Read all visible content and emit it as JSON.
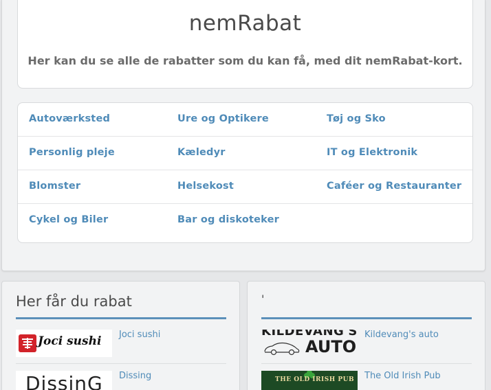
{
  "header": {
    "title": "nemRabat",
    "subtitle": "Her kan du se alle de rabatter som du kan få, med dit nemRabat-kort."
  },
  "categories": [
    [
      "Autoværksted",
      "Ure og Optikere",
      "Tøj og Sko"
    ],
    [
      "Personlig pleje",
      "Kæledyr",
      "IT og Elektronik"
    ],
    [
      "Blomster",
      "Helsekost",
      "Caféer og Restauranter"
    ],
    [
      "Cykel og Biler",
      "Bar og diskoteker",
      ""
    ]
  ],
  "left_panel": {
    "title": "Her får du rabat",
    "entries": [
      {
        "name": "Joci sushi",
        "logo_text": "Joci sushi",
        "logo_icon": "sushi-kanji-icon"
      },
      {
        "name": "Dissing",
        "logo_text": "DissinG"
      }
    ]
  },
  "right_panel": {
    "title": "'",
    "entries": [
      {
        "name": "Kildevang's auto",
        "logo_text_top": "KILDEVANG'S",
        "logo_text_bottom": "AUTO",
        "logo_icon": "car-outline-icon"
      },
      {
        "name": "The Old Irish Pub",
        "logo_text": "THE OLD IRISH PUB",
        "logo_icon": "shamrock-icon"
      }
    ]
  },
  "colors": {
    "link": "#4f8bb8",
    "accent_rule": "#5b8fb9",
    "page_bg": "#e6e7e9",
    "panel_bg": "#f2f3f4"
  }
}
